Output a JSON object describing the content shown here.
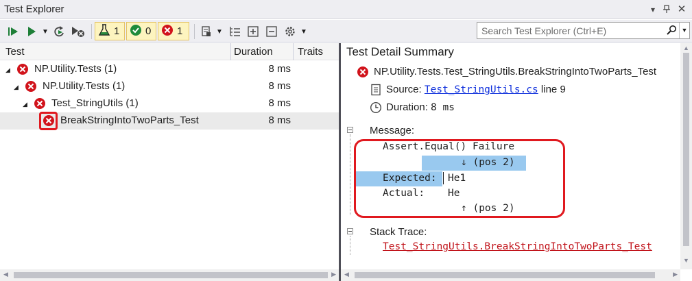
{
  "window": {
    "title": "Test Explorer"
  },
  "toolbar": {
    "counters": [
      {
        "kind": "total",
        "value": "1"
      },
      {
        "kind": "passed",
        "value": "0"
      },
      {
        "kind": "failed",
        "value": "1"
      }
    ]
  },
  "search": {
    "placeholder": "Search Test Explorer (Ctrl+E)"
  },
  "columns": {
    "test": "Test",
    "duration": "Duration",
    "traits": "Traits"
  },
  "tree": [
    {
      "label": "NP.Utility.Tests  (1)",
      "duration": "8 ms",
      "status": "failed"
    },
    {
      "label": "NP.Utility.Tests  (1)",
      "duration": "8 ms",
      "status": "failed"
    },
    {
      "label": "Test_StringUtils  (1)",
      "duration": "8 ms",
      "status": "failed"
    },
    {
      "label": "BreakStringIntoTwoParts_Test",
      "duration": "8 ms",
      "status": "failed"
    }
  ],
  "detail": {
    "title": "Test Detail Summary",
    "test_name": "NP.Utility.Tests.Test_StringUtils.BreakStringIntoTwoParts_Test",
    "source_label": "Source:",
    "source_file": "Test_StringUtils.cs",
    "source_line": "line 9",
    "duration_label": "Duration:",
    "duration_value": "8 ms",
    "message_label": "Message:",
    "message_lines": {
      "l1": "Assert.Equal() Failure",
      "l2": "↓ (pos 2)",
      "l3_label": "Expected:",
      "l3_value": "He1",
      "l4_label": "Actual:",
      "l4_value": "He",
      "l5": "↑ (pos 2)"
    },
    "stack_label": "Stack Trace:",
    "stack_link": "Test_StringUtils.BreakStringIntoTwoParts_Test"
  },
  "colors": {
    "error": "#d1131b",
    "highlight": "#99c9ef",
    "annotation": "#e0191f",
    "link": "#0e2fdc"
  }
}
